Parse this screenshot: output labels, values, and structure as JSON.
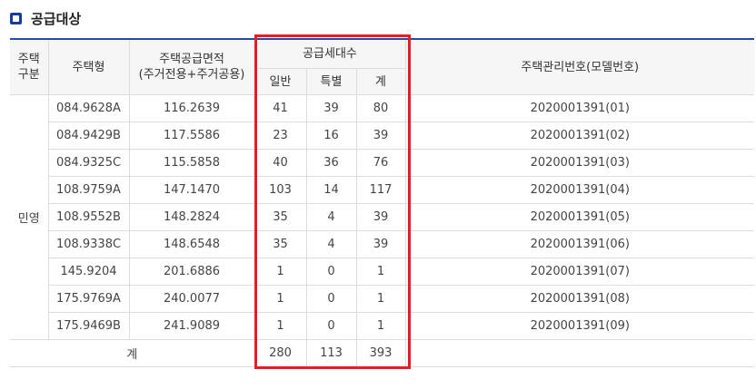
{
  "section": {
    "title": "공급대상",
    "icon": "square-bullet-icon",
    "accent": "#1a3a9c"
  },
  "table": {
    "headers": {
      "type_division": "주택\n구분",
      "housing_type": "주택형",
      "supply_area_line1": "주택공급면적",
      "supply_area_line2": "(주거전용+주거공용)",
      "households": "공급세대수",
      "general": "일반",
      "special": "특별",
      "sum": "계",
      "management_no": "주택관리번호(모델번호)"
    },
    "group_label": "민영",
    "rows": [
      {
        "type": "084.9628A",
        "area": "116.2639",
        "general": "41",
        "special": "39",
        "sum": "80",
        "mgmt": "2020001391(01)"
      },
      {
        "type": "084.9429B",
        "area": "117.5586",
        "general": "23",
        "special": "16",
        "sum": "39",
        "mgmt": "2020001391(02)"
      },
      {
        "type": "084.9325C",
        "area": "115.5858",
        "general": "40",
        "special": "36",
        "sum": "76",
        "mgmt": "2020001391(03)"
      },
      {
        "type": "108.9759A",
        "area": "147.1470",
        "general": "103",
        "special": "14",
        "sum": "117",
        "mgmt": "2020001391(04)"
      },
      {
        "type": "108.9552B",
        "area": "148.2824",
        "general": "35",
        "special": "4",
        "sum": "39",
        "mgmt": "2020001391(05)"
      },
      {
        "type": "108.9338C",
        "area": "148.6548",
        "general": "35",
        "special": "4",
        "sum": "39",
        "mgmt": "2020001391(06)"
      },
      {
        "type": "145.9204",
        "area": "201.6886",
        "general": "1",
        "special": "0",
        "sum": "1",
        "mgmt": "2020001391(07)"
      },
      {
        "type": "175.9769A",
        "area": "240.0077",
        "general": "1",
        "special": "0",
        "sum": "1",
        "mgmt": "2020001391(08)"
      },
      {
        "type": "175.9469B",
        "area": "241.9089",
        "general": "1",
        "special": "0",
        "sum": "1",
        "mgmt": "2020001391(09)"
      }
    ],
    "total": {
      "label": "계",
      "general": "280",
      "special": "113",
      "sum": "393"
    }
  },
  "highlight_color": "#e41e26"
}
